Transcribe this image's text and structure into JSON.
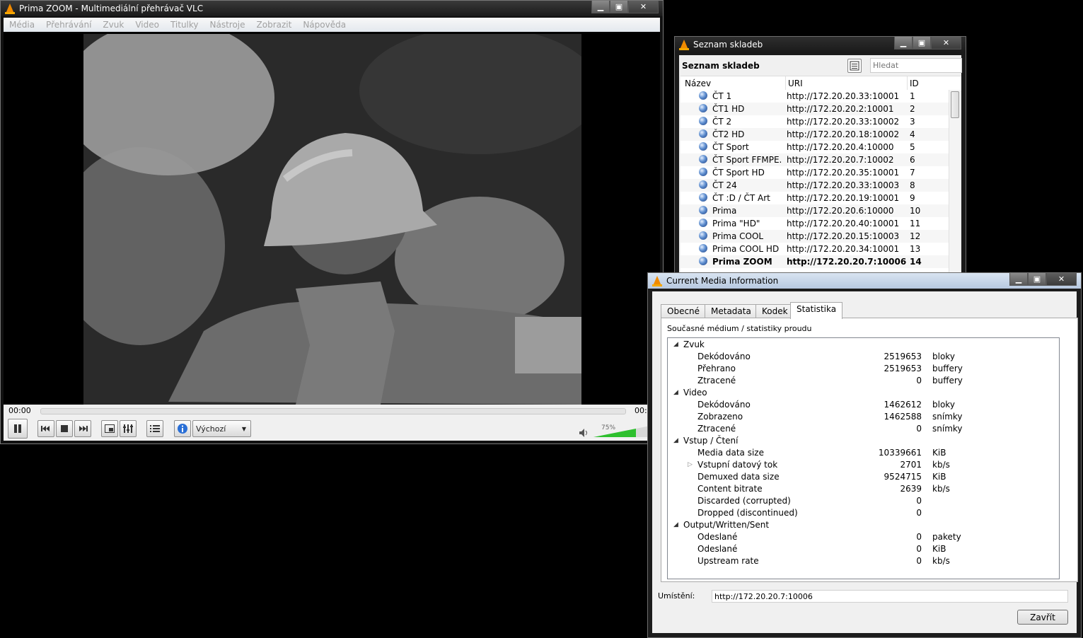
{
  "vlc": {
    "title": "Prima ZOOM - Multimediální přehrávač VLC",
    "menu": [
      "Média",
      "Přehrávání",
      "Zvuk",
      "Video",
      "Titulky",
      "Nástroje",
      "Zobrazit",
      "Nápověda"
    ],
    "time_elapsed": "00:00",
    "time_total": "00:",
    "aspect_select": "Výchozí",
    "volume_label": "75%",
    "volume_level": 0.75,
    "win_buttons": [
      "▁",
      "▣",
      "✕"
    ]
  },
  "playlist": {
    "title": "Seznam skladeb",
    "header_label": "Seznam skladeb",
    "search_placeholder": "Hledat",
    "columns": [
      "Název",
      "URI",
      "ID"
    ],
    "rows": [
      {
        "name": "ČT 1",
        "uri": "http://172.20.20.33:10001",
        "id": "1"
      },
      {
        "name": "ČT1 HD",
        "uri": "http://172.20.20.2:10001",
        "id": "2"
      },
      {
        "name": "ČT 2",
        "uri": "http://172.20.20.33:10002",
        "id": "3"
      },
      {
        "name": "ČT2 HD",
        "uri": "http://172.20.20.18:10002",
        "id": "4"
      },
      {
        "name": "ČT Sport",
        "uri": "http://172.20.20.4:10000",
        "id": "5"
      },
      {
        "name": "ČT Sport FFMPE...",
        "uri": "http://172.20.20.7:10002",
        "id": "6"
      },
      {
        "name": " ČT Sport HD",
        "uri": "http://172.20.20.35:10001",
        "id": "7"
      },
      {
        "name": "ČT 24",
        "uri": "http://172.20.20.33:10003",
        "id": "8"
      },
      {
        "name": "ČT :D / ČT Art",
        "uri": "http://172.20.20.19:10001",
        "id": "9"
      },
      {
        "name": "Prima",
        "uri": "http://172.20.20.6:10000",
        "id": "10"
      },
      {
        "name": "Prima \"HD\"",
        "uri": "http://172.20.20.40:10001",
        "id": "11"
      },
      {
        "name": "Prima COOL",
        "uri": "http://172.20.20.15:10003",
        "id": "12"
      },
      {
        "name": "Prima COOL HD",
        "uri": "http://172.20.20.34:10001",
        "id": "13"
      },
      {
        "name": "Prima ZOOM",
        "uri": "http://172.20.20.7:10006",
        "id": "14",
        "current": true
      }
    ]
  },
  "info": {
    "title": "Current Media Information",
    "tabs": [
      "Obecné",
      "Metadata",
      "Kodek",
      "Statistika"
    ],
    "panel_heading": "Současné médium / statistiky proudu",
    "tree": [
      {
        "level": 0,
        "label": "Zvuk",
        "expanded": true
      },
      {
        "level": 1,
        "label": "Dekódováno",
        "value": "2519653",
        "unit": "bloky"
      },
      {
        "level": 1,
        "label": "Přehrano",
        "value": "2519653",
        "unit": "buffery"
      },
      {
        "level": 1,
        "label": "Ztracené",
        "value": "0",
        "unit": "buffery"
      },
      {
        "level": 0,
        "label": "Video",
        "expanded": true
      },
      {
        "level": 1,
        "label": "Dekódováno",
        "value": "1462612",
        "unit": "bloky"
      },
      {
        "level": 1,
        "label": "Zobrazeno",
        "value": "1462588",
        "unit": "snímky"
      },
      {
        "level": 1,
        "label": "Ztracené",
        "value": "0",
        "unit": "snímky"
      },
      {
        "level": 0,
        "label": "Vstup / Čtení",
        "expanded": true
      },
      {
        "level": 1,
        "label": "Media data size",
        "value": "10339661",
        "unit": "KiB"
      },
      {
        "level": 1,
        "label": "Vstupní datový tok",
        "value": "2701",
        "unit": "kb/s",
        "collapsed_child": true
      },
      {
        "level": 1,
        "label": "Demuxed data size",
        "value": "9524715",
        "unit": "KiB"
      },
      {
        "level": 1,
        "label": "Content bitrate",
        "value": "2639",
        "unit": "kb/s"
      },
      {
        "level": 1,
        "label": "Discarded (corrupted)",
        "value": "0",
        "unit": ""
      },
      {
        "level": 1,
        "label": "Dropped (discontinued)",
        "value": "0",
        "unit": ""
      },
      {
        "level": 0,
        "label": "Output/Written/Sent",
        "expanded": true
      },
      {
        "level": 1,
        "label": "Odeslané",
        "value": "0",
        "unit": "pakety"
      },
      {
        "level": 1,
        "label": "Odeslané",
        "value": "0",
        "unit": "KiB"
      },
      {
        "level": 1,
        "label": "Upstream rate",
        "value": "0",
        "unit": "kb/s"
      }
    ],
    "location_label": "Umístění:",
    "location_value": "http://172.20.20.7:10006",
    "close_button": "Zavřít"
  }
}
